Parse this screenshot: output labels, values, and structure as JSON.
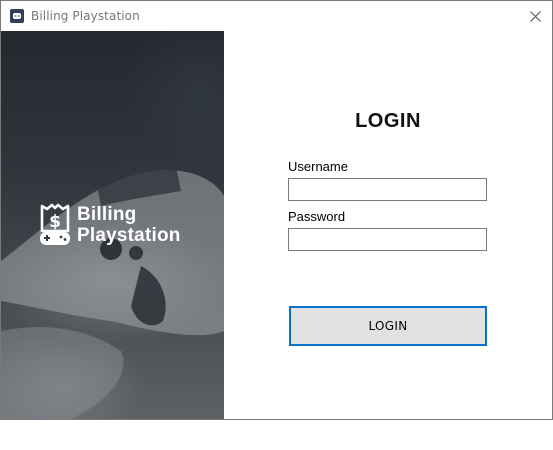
{
  "window": {
    "title": "Billing Playstation",
    "app_icon": "gamepad-icon",
    "close_icon": "close-icon"
  },
  "brand": {
    "logo_icon": "dollar-gamepad-logo-icon",
    "line1": "Billing",
    "line2": "Playstation"
  },
  "form": {
    "heading": "LOGIN",
    "username_label": "Username",
    "username_value": "",
    "password_label": "Password",
    "password_value": "",
    "login_button": "LOGIN"
  },
  "colors": {
    "button_border": "#0a72cc",
    "button_bg": "#e1e1e1",
    "brand_text": "#ffffff"
  }
}
